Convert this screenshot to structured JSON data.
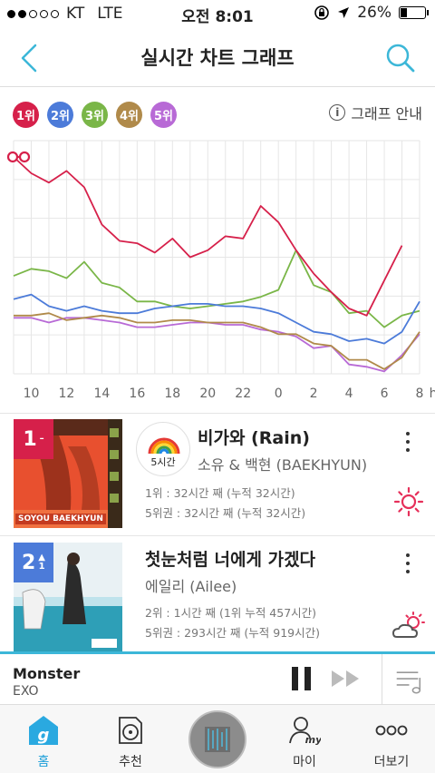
{
  "status_bar": {
    "carrier": "KT",
    "network": "LTE",
    "time": "오전 8:01",
    "battery": "26%",
    "battery_level": 0.26
  },
  "header": {
    "title": "실시간 차트 그래프"
  },
  "legend": {
    "items": [
      {
        "label": "1위",
        "color": "#d6204a"
      },
      {
        "label": "2위",
        "color": "#4c7bd9"
      },
      {
        "label": "3위",
        "color": "#7ab648"
      },
      {
        "label": "4위",
        "color": "#b08a4a"
      },
      {
        "label": "5위",
        "color": "#b86ad6"
      }
    ],
    "guide_label": "그래프 안내"
  },
  "chart_data": {
    "type": "line",
    "x": [
      "9",
      "10",
      "11",
      "12",
      "13",
      "14",
      "15",
      "16",
      "17",
      "18",
      "19",
      "20",
      "21",
      "22",
      "23",
      "0",
      "1",
      "2",
      "3",
      "4",
      "5",
      "6",
      "7",
      "8"
    ],
    "tick_labels": [
      "10",
      "12",
      "14",
      "16",
      "18",
      "20",
      "22",
      "0",
      "2",
      "4",
      "6",
      "8"
    ],
    "unit_label": "h",
    "grid": true,
    "series": [
      {
        "name": "1위",
        "color": "#d6204a",
        "values": [
          93,
          86,
          82,
          87,
          80,
          64,
          57,
          56,
          52,
          58,
          50,
          53,
          59,
          58,
          72,
          65,
          53,
          43,
          35,
          28,
          25,
          40,
          55
        ]
      },
      {
        "name": "2위",
        "color": "#4c7bd9",
        "values": [
          32,
          34,
          29,
          27,
          29,
          27,
          26,
          26,
          28,
          29,
          30,
          30,
          29,
          29,
          28,
          26,
          22,
          18,
          17,
          14,
          15,
          13,
          18,
          31
        ]
      },
      {
        "name": "3위",
        "color": "#7ab648",
        "values": [
          42,
          45,
          44,
          41,
          48,
          39,
          37,
          31,
          31,
          29,
          28,
          29,
          30,
          31,
          33,
          36,
          53,
          38,
          35,
          26,
          27,
          20,
          25,
          27
        ]
      },
      {
        "name": "4위",
        "color": "#b08a4a",
        "values": [
          25,
          25,
          26,
          23,
          24,
          25,
          24,
          22,
          22,
          23,
          23,
          22,
          22,
          22,
          20,
          17,
          17,
          13,
          12,
          6,
          6,
          2,
          7,
          18
        ]
      },
      {
        "name": "5위",
        "color": "#b86ad6",
        "values": [
          24,
          24,
          22,
          24,
          24,
          23,
          22,
          20,
          20,
          21,
          22,
          22,
          21,
          21,
          19,
          18,
          16,
          11,
          12,
          4,
          3,
          1,
          8,
          17
        ]
      }
    ]
  },
  "songs": [
    {
      "rank": "1",
      "rank_change": "–",
      "rank_color": "#d6204a",
      "title": "비가와 (Rain)",
      "artist": "소유 & 백현 (BAEKHYUN)",
      "stat1": "1위 : 32시간 째 (누적 32시간)",
      "stat2": "5위권 : 32시간 째 (누적 32시간)",
      "badge_label": "5시간",
      "cover_text": "SOYOU BAEKHYUN",
      "weather_icon": "sun-icon"
    },
    {
      "rank": "2",
      "rank_change": "1",
      "rank_color": "#4c7bd9",
      "title": "첫눈처럼 너에게 가겠다",
      "artist": "에일리 (Ailee)",
      "stat1": "2위 : 1시간 째 (1위 누적 457시간)",
      "stat2": "5위권 : 293시간 째 (누적 919시간)",
      "weather_icon": "sun-cloud-icon"
    }
  ],
  "player": {
    "song": "Monster",
    "artist": "EXO"
  },
  "tabbar": {
    "items": [
      {
        "label": "홈",
        "icon": "home-g-icon"
      },
      {
        "label": "추천",
        "icon": "recommend-disc-icon"
      },
      {
        "label": "",
        "icon": "now-playing-cover"
      },
      {
        "label": "마이",
        "icon": "my-person-icon"
      },
      {
        "label": "더보기",
        "icon": "more-dots-icon"
      }
    ]
  }
}
